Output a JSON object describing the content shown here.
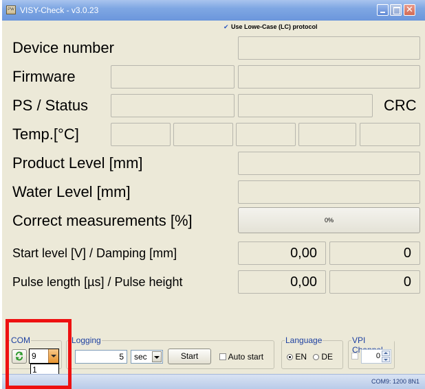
{
  "window": {
    "title": "VISY-Check - v3.0.23",
    "app_icon_text": "PW"
  },
  "lc_protocol": {
    "label": "Use Lowe-Case (LC) protocol",
    "checked": true
  },
  "rows": {
    "device_number": "Device number",
    "firmware": "Firmware",
    "ps_status": "PS / Status",
    "crc": "CRC",
    "temp": "Temp.[°C]",
    "product_level": "Product Level [mm]",
    "water_level": "Water Level [mm]",
    "correct_measurements": "Correct measurements [%]",
    "start_level": "Start level [V] / Damping [mm]",
    "pulse_length": "Pulse length [µs] / Pulse height"
  },
  "values": {
    "correct_measurements": "0%",
    "correct_measurements_fraction": 0,
    "start_level": "0,00",
    "damping": "0",
    "pulse_length": "0,00",
    "pulse_height": "0"
  },
  "com": {
    "label": "COM",
    "value": "9",
    "options": [
      "1",
      "9"
    ],
    "selected": "9",
    "refresh_icon": "refresh-icon"
  },
  "logging": {
    "label": "Logging",
    "interval": "5",
    "unit": "sec",
    "start": "Start",
    "auto_start": "Auto start"
  },
  "language": {
    "label": "Language",
    "en": "EN",
    "de": "DE",
    "selected": "EN"
  },
  "vpi": {
    "label": "VPI Channel",
    "value": "0"
  },
  "status": {
    "text": "COM9: 1200 8N1"
  },
  "colors": {
    "highlight": "#ee1111",
    "titlebar": "#7fa7e3",
    "window": "#ece9d8"
  }
}
